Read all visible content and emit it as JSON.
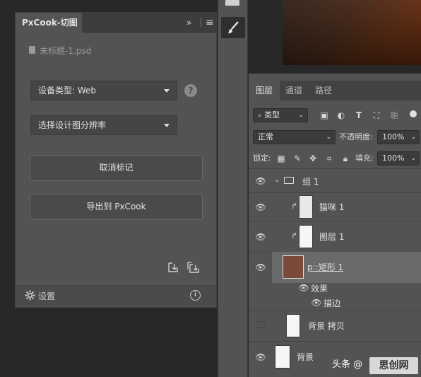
{
  "pxcook": {
    "title": "PxCook-切图",
    "expand_icon": "»",
    "menu_icon": "≡",
    "filename": "未标题-1.psd",
    "device_type": "设备类型: Web",
    "help": "?",
    "resolution_placeholder": "选择设计图分辨率",
    "cancel_mark": "取消标记",
    "export": "导出到 PxCook",
    "settings": "设置",
    "info": "i",
    "icons": [
      "file-icon",
      "help-icon",
      "import-icon",
      "multi-import-icon",
      "gear-icon",
      "info-icon"
    ]
  },
  "layers_panel": {
    "tabs": [
      "图层",
      "通道",
      "路径"
    ],
    "filter_kind": "类型",
    "blend_mode": "正常",
    "opacity_label": "不透明度:",
    "opacity_value": "100%",
    "lock_label": "锁定:",
    "fill_label": "填充:",
    "fill_value": "100%",
    "layers": [
      {
        "name": "组 1",
        "type": "group"
      },
      {
        "name": "猫咪 1",
        "type": "clipped"
      },
      {
        "name": "图层 1",
        "type": "clipped"
      },
      {
        "name": "p::矩形 1",
        "type": "shape",
        "selected": true
      },
      {
        "name": "效果",
        "type": "effects"
      },
      {
        "name": "描边",
        "type": "effect"
      },
      {
        "name": "背景 拷贝",
        "type": "layer",
        "hidden": true
      },
      {
        "name": "背景",
        "type": "layer"
      }
    ]
  },
  "watermark": {
    "text": "头条 @",
    "logo": "思创网"
  },
  "colors": {
    "panel_bg": "#535353",
    "app_bg": "#282828",
    "selected_row": "#6a6a6a",
    "shape_fill": "#7a4a3a"
  }
}
